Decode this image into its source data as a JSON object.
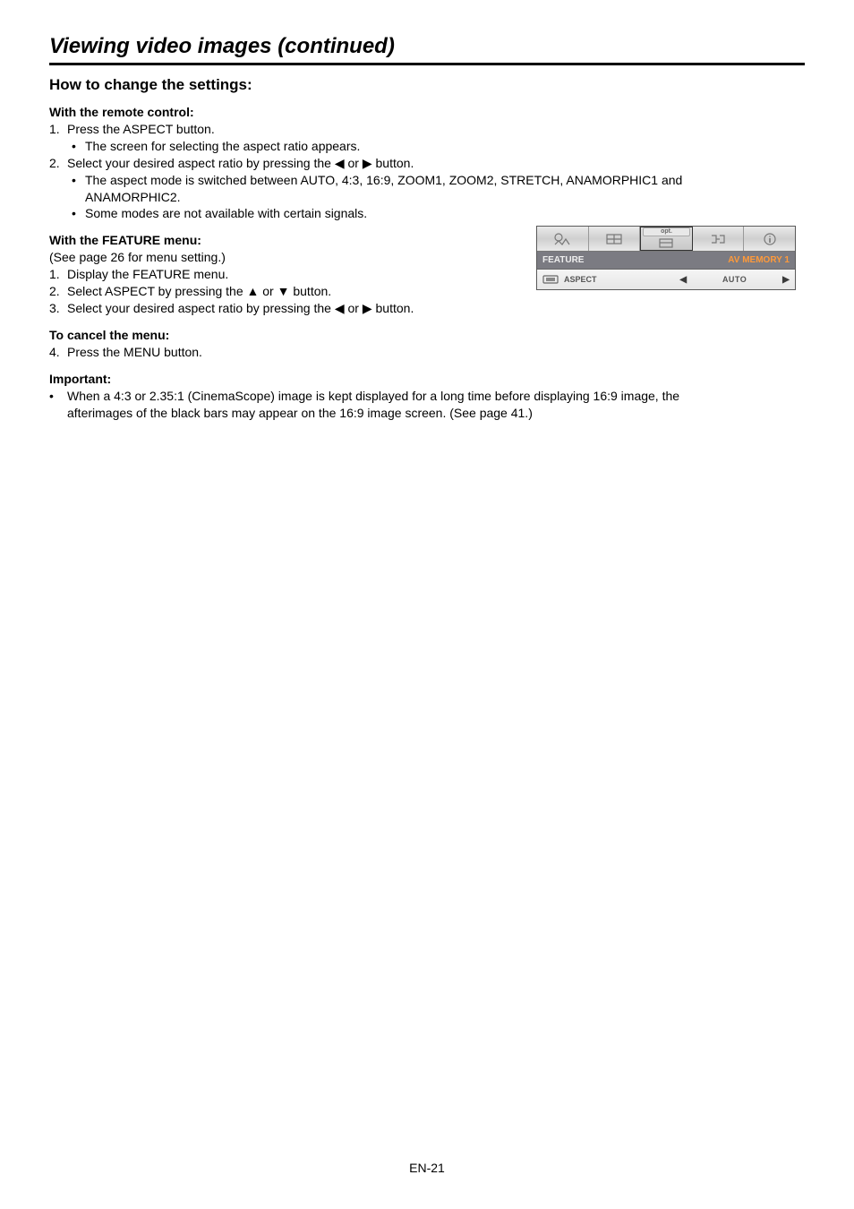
{
  "title": "Viewing video images (continued)",
  "h2": "How to change the settings:",
  "remote": {
    "heading": "With the remote control:",
    "step1": "Press the ASPECT button.",
    "step1_bullet": "The screen for selecting the aspect ratio appears.",
    "step2_pre": "Select your desired aspect ratio by pressing the ",
    "step2_mid": " or ",
    "step2_post": " button.",
    "step2_bullet1_a": "The aspect mode is switched between AUTO, 4:3, 16:9, ZOOM1, ZOOM2, STRETCH, ANAMORPHIC1 and",
    "step2_bullet1_b": "ANAMORPHIC2.",
    "step2_bullet2": "Some modes are not available with certain signals."
  },
  "feature": {
    "heading": "With the FEATURE menu:",
    "note": "(See page 26 for menu setting.)",
    "step1": "Display the FEATURE menu.",
    "step2_pre": "Select ASPECT by pressing the ",
    "step2_mid": " or ",
    "step2_post": " button.",
    "step3_pre": "Select your desired aspect ratio by pressing the ",
    "step3_mid": " or ",
    "step3_post": " button."
  },
  "cancel": {
    "heading": "To cancel the menu:",
    "step4": "Press the MENU button."
  },
  "important": {
    "heading": "Important:",
    "bullet_a": "When a 4:3 or 2.35:1 (CinemaScope) image is kept displayed for a long time before displaying 16:9 image, the",
    "bullet_b": "afterimages of the black bars may appear on the 16:9 image screen. (See page 41.)"
  },
  "osd": {
    "opt_label": "opt.",
    "feature_label": "FEATURE",
    "memory_label": "AV MEMORY 1",
    "row_label": "ASPECT",
    "row_value": "AUTO"
  },
  "glyphs": {
    "left": "◀",
    "right": "▶",
    "up": "▲",
    "down": "▼"
  },
  "footer": "EN-21"
}
